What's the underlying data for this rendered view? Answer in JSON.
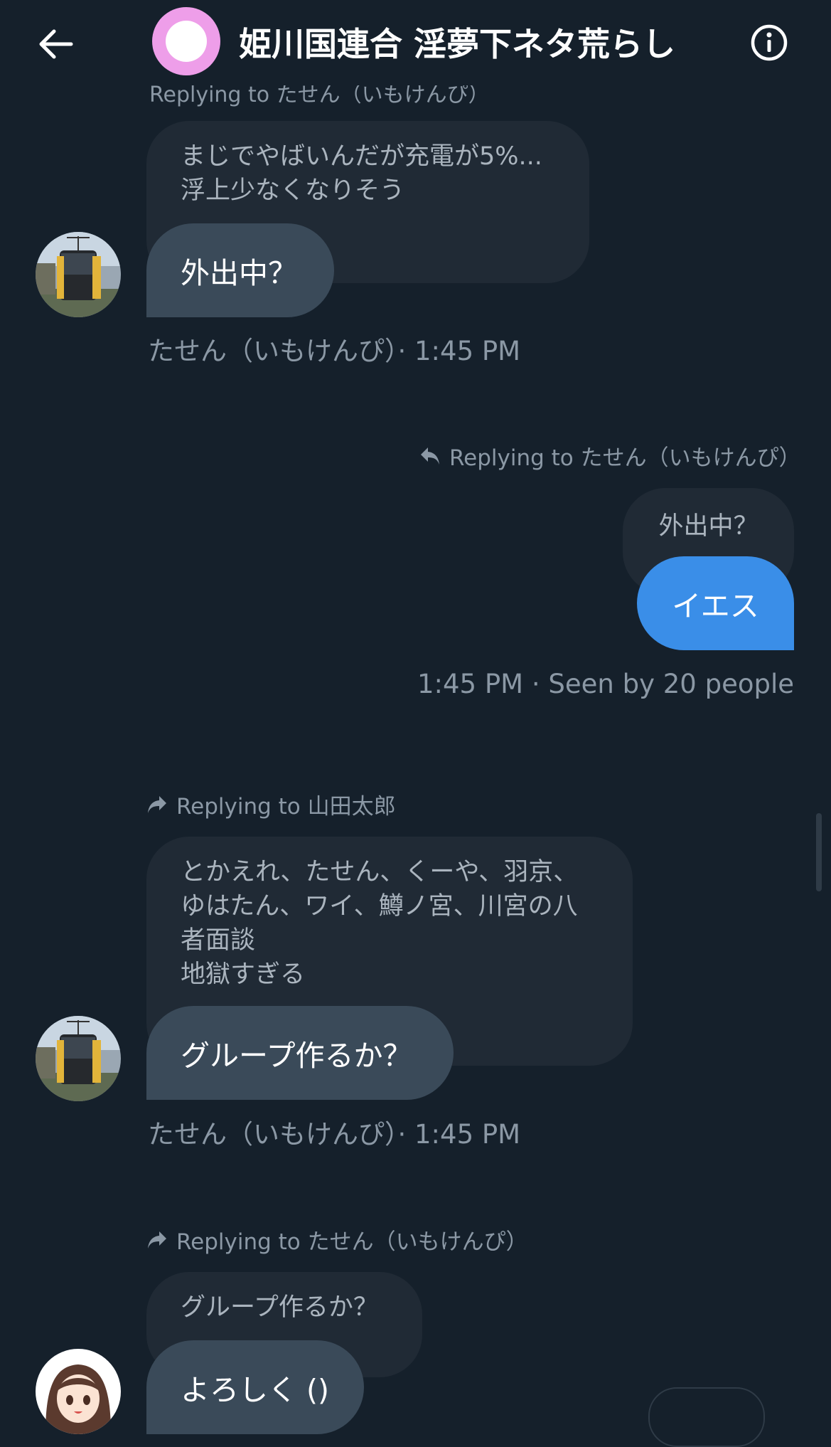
{
  "header": {
    "title": "姫川国連合 淫夢下ネタ荒らし",
    "back_icon": "arrow-left-icon",
    "info_icon": "info-icon",
    "avatar_color": "#ee9ee9"
  },
  "partial_reply": "Replying to たせん（いもけんぴ）",
  "messages": [
    {
      "quote": "まじでやばいんだが充電が5%...\n浮上少なくなりそう",
      "text": "外出中？",
      "meta": "たせん（いもけんぴ）· 1:45 PM"
    },
    {
      "reply_to": "Replying to たせん（いもけんぴ）",
      "quote": "外出中？",
      "text": "イエス",
      "meta": "1:45 PM · Seen by 20 people"
    },
    {
      "reply_to": "Replying to 山田太郎",
      "quote": "とかえれ、たせん、くーや、羽京、\nゆはたん、ワイ、鱒ノ宮、川宮の八\n者面談\n地獄すぎる",
      "text": "グループ作るか？",
      "meta": "たせん（いもけんぴ）· 1:45 PM"
    },
    {
      "reply_to": "Replying to たせん（いもけんぴ）",
      "quote": "グループ作るか？",
      "text": "よろしく ()"
    }
  ],
  "colors": {
    "background": "#15202b",
    "incoming_bubble": "#3a4a59",
    "outgoing_bubble": "#3a8ee8",
    "quote_bubble": "#202a35",
    "muted_text": "#8b98a5"
  }
}
